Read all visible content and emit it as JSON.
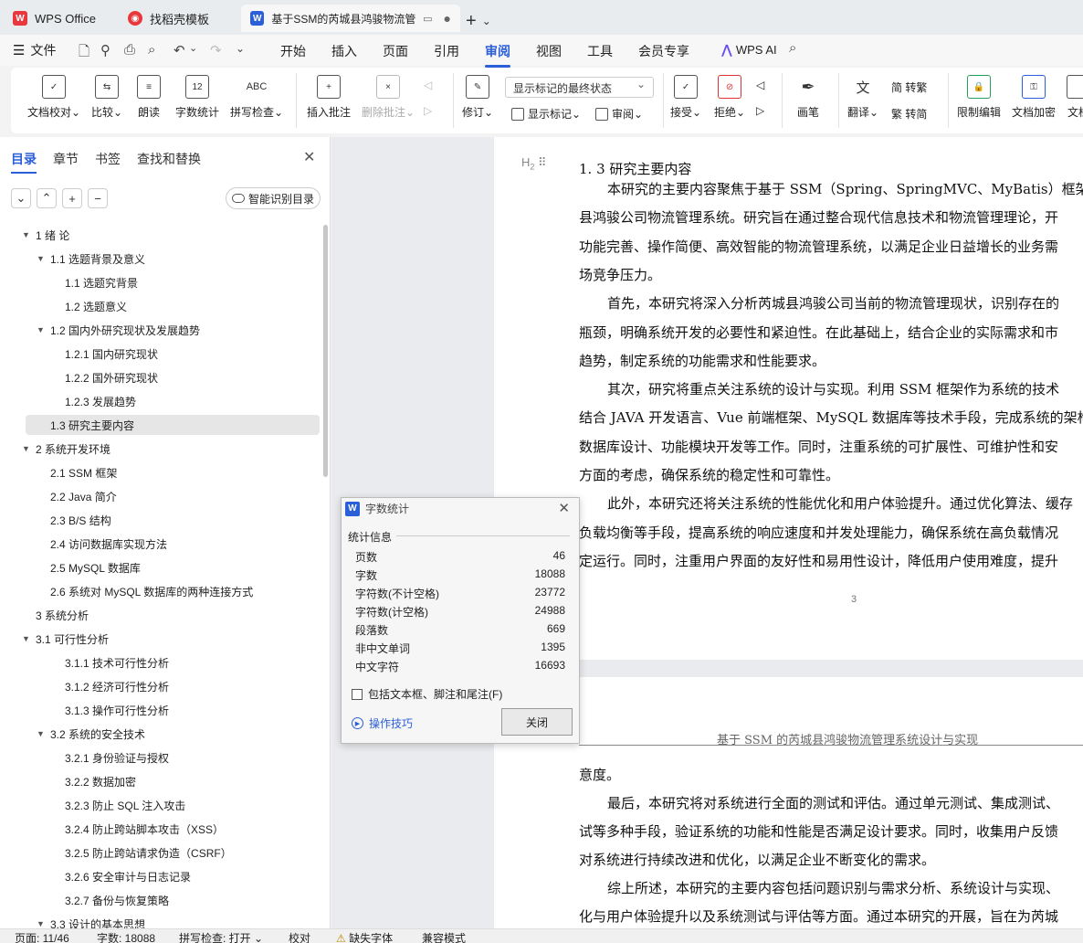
{
  "tabs": {
    "wps": "WPS Office",
    "daoke": "找稻壳模板",
    "doc": "基于SSM的芮城县鸿骏物流管"
  },
  "menu": {
    "file": "文件",
    "items": [
      "开始",
      "插入",
      "页面",
      "引用",
      "审阅",
      "视图",
      "工具",
      "会员专享"
    ],
    "ai": "WPS AI"
  },
  "ribbon": {
    "doc_check": "文档校对",
    "compare": "比较",
    "read_aloud": "朗读",
    "word_count": "字数统计",
    "spell_check": "拼写检查",
    "insert_comment": "插入批注",
    "delete_comment": "删除批注",
    "revise": "修订",
    "markup_state": "显示标记的最终状态",
    "show_markup": "显示标记",
    "review": "审阅",
    "accept": "接受",
    "reject": "拒绝",
    "pen": "画笔",
    "translate": "翻译",
    "to_traditional": "简 转繁",
    "to_simplified": "繁 转简",
    "restrict_edit": "限制编辑",
    "encrypt": "文档加密",
    "doc_more": "文档"
  },
  "nav": {
    "tabs": [
      "目录",
      "章节",
      "书签",
      "查找和替换"
    ],
    "smart_toc": "智能识别目录",
    "toc": [
      "1 绪 论",
      "1.1 选题背景及意义",
      "1.1 选题究背景",
      "1.2 选题意义",
      "1.2 国内外研究现状及发展趋势",
      "1.2.1 国内研究现状",
      "1.2.2 国外研究现状",
      "1.2.3 发展趋势",
      "1.3 研究主要内容",
      "2 系统开发环境",
      "2.1 SSM 框架",
      "2.2 Java 简介",
      "2.3 B/S 结构",
      "2.4 访问数据库实现方法",
      "2.5 MySQL 数据库",
      "2.6 系统对 MySQL 数据库的两种连接方式",
      "3 系统分析",
      "3.1 可行性分析",
      "3.1.1 技术可行性分析",
      "3.1.2 经济可行性分析",
      "3.1.3 操作可行性分析",
      "3.2 系统的安全技术",
      "3.2.1 身份验证与授权",
      "3.2.2 数据加密",
      "3.2.3 防止 SQL 注入攻击",
      "3.2.4 防止跨站脚本攻击（XSS）",
      "3.2.5 防止跨站请求伪造（CSRF）",
      "3.2.6 安全审计与日志记录",
      "3.2.7 备份与恢复策略",
      "3.3 设计的基本思想"
    ]
  },
  "doc": {
    "heading": "1. 3 研究主要内容",
    "page1_lines": [
      "本研究的主要内容聚焦于基于 SSM（Spring、SpringMVC、MyBatis）框架",
      "县鸿骏公司物流管理系统。研究旨在通过整合现代信息技术和物流管理理论，开",
      "功能完善、操作简便、高效智能的物流管理系统，以满足企业日益增长的业务需",
      "场竞争压力。",
      "首先，本研究将深入分析芮城县鸿骏公司当前的物流管理现状，识别存在的",
      "瓶颈，明确系统开发的必要性和紧迫性。在此基础上，结合企业的实际需求和市",
      "趋势，制定系统的功能需求和性能要求。",
      "其次，研究将重点关注系统的设计与实现。利用 SSM 框架作为系统的技术",
      "结合 JAVA 开发语言、Vue 前端框架、MySQL 数据库等技术手段，完成系统的架构",
      "数据库设计、功能模块开发等工作。同时，注重系统的可扩展性、可维护性和安",
      "方面的考虑，确保系统的稳定性和可靠性。",
      "此外，本研究还将关注系统的性能优化和用户体验提升。通过优化算法、缓存",
      "负载均衡等手段，提高系统的响应速度和并发处理能力，确保系统在高负载情况",
      "定运行。同时，注重用户界面的友好性和易用性设计，降低用户使用难度，提升"
    ],
    "page_number": "3",
    "running_header": "基于 SSM 的芮城县鸿骏物流管理系统设计与实现",
    "page2_lines": [
      "意度。",
      "最后，本研究将对系统进行全面的测试和评估。通过单元测试、集成测试、",
      "试等多种手段，验证系统的功能和性能是否满足设计要求。同时，收集用户反馈",
      "对系统进行持续改进和优化，以满足企业不断变化的需求。",
      "综上所述，本研究的主要内容包括问题识别与需求分析、系统设计与实现、",
      "化与用户体验提升以及系统测试与评估等方面。通过本研究的开展，旨在为芮城"
    ]
  },
  "dialog": {
    "title": "字数统计",
    "section": "统计信息",
    "rows": [
      {
        "label": "页数",
        "value": "46"
      },
      {
        "label": "字数",
        "value": "18088"
      },
      {
        "label": "字符数(不计空格)",
        "value": "23772"
      },
      {
        "label": "字符数(计空格)",
        "value": "24988"
      },
      {
        "label": "段落数",
        "value": "669"
      },
      {
        "label": "非中文单词",
        "value": "1395"
      },
      {
        "label": "中文字符",
        "value": "16693"
      }
    ],
    "checkbox": "包括文本框、脚注和尾注(F)",
    "tips": "操作技巧",
    "close": "关闭"
  },
  "status": {
    "page": "页面: 11/46",
    "words": "字数: 18088",
    "spell": "拼写检查: 打开",
    "proof": "校对",
    "missing_font": "缺失字体",
    "compat": "兼容模式"
  }
}
